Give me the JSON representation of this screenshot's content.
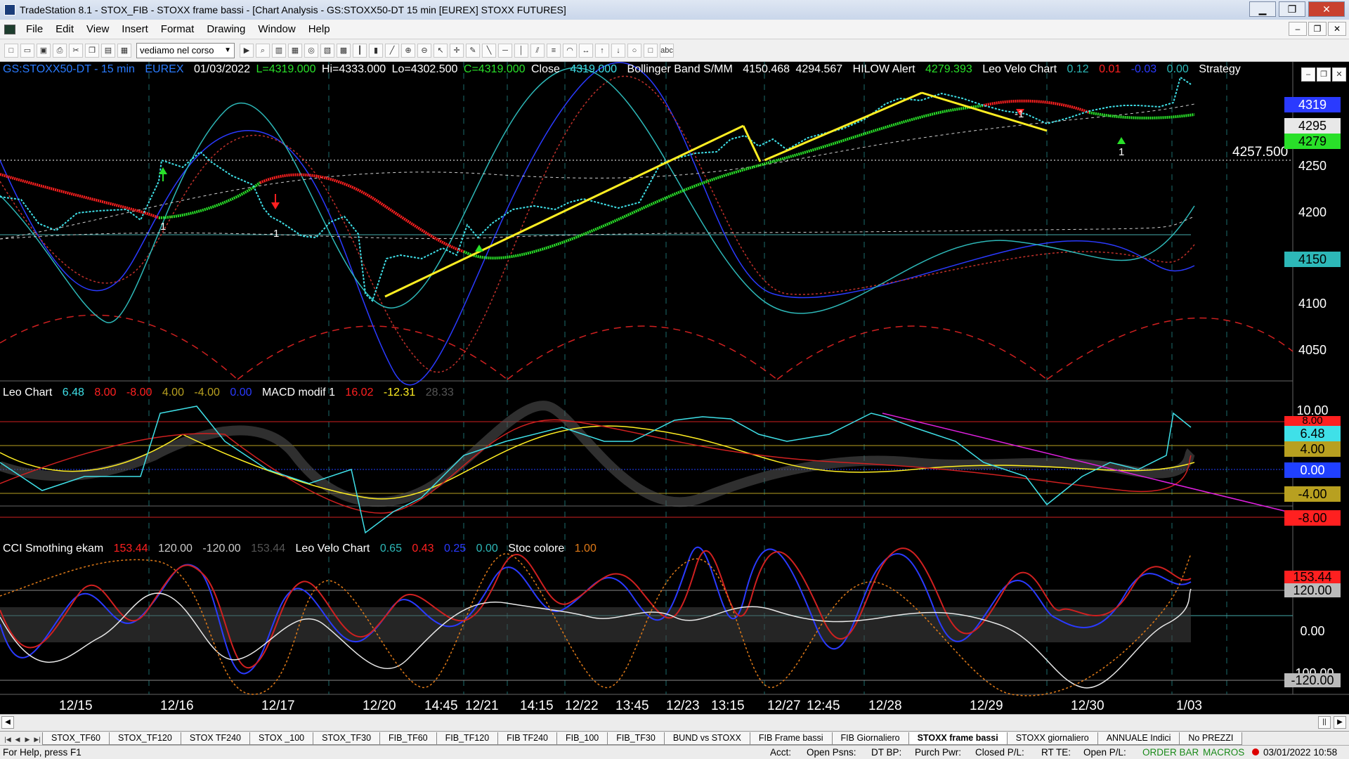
{
  "window": {
    "title": "TradeStation 8.1 - STOX_FIB - STOXX frame bassi - [Chart Analysis - GS:STOXX50-DT  15 min  [EUREX] STOXX FUTURES]",
    "minimize": "▁",
    "restore": "❐",
    "close": "✕"
  },
  "menu": [
    "File",
    "Edit",
    "View",
    "Insert",
    "Format",
    "Drawing",
    "Window",
    "Help"
  ],
  "mdi_buttons": [
    "–",
    "❐",
    "✕"
  ],
  "toolbar": {
    "select_value": "vediamo nel corso",
    "icons": [
      "new-icon",
      "open-icon",
      "save-icon",
      "print-icon",
      "cut-icon",
      "copy-icon",
      "paste-icon",
      "chart-icon",
      "matrix-icon",
      "radar-icon",
      "scanner-icon",
      "zoom-in-icon",
      "zoom-out-icon",
      "pointer-icon",
      "crosshair-icon",
      "trendline-icon",
      "horizontal-line-icon",
      "fibonacci-icon",
      "text-icon"
    ]
  },
  "panes": {
    "price": {
      "symbol": "GS:STOXX50-DT - 15 min",
      "exchange": "EUREX",
      "date": "01/03/2022",
      "last": "L=4319.000",
      "high": "Hi=4333.000",
      "low": "Lo=4302.500",
      "close_val": "C=4319.000",
      "close_lbl": "Close",
      "close_num": "4319.000",
      "bb_lbl": "Bollinger Band S/MM",
      "bb1": "4150.468",
      "bb2": "4294.567",
      "hilow_lbl": "HILOW Alert",
      "hilow": "4279.393",
      "leo_lbl": "Leo Velo Chart",
      "leo1": "0.12",
      "leo2": "0.01",
      "leo3": "-0.03",
      "leo4": "0.00",
      "strategy_lbl": "Strategy",
      "hline_label": "4257.500",
      "marker_neg1": "-1",
      "marker_pos1": "1",
      "tags": {
        "t4319": "4319",
        "t4295": "4295",
        "t4279": "4279",
        "t4150": "4150"
      },
      "axis": [
        "4250",
        "4200",
        "4150",
        "4100",
        "4050"
      ]
    },
    "macd": {
      "leo_lbl": "Leo Chart",
      "v1": "6.48",
      "v2": "8.00",
      "v3": "-8.00",
      "v4": "4.00",
      "v5": "-4.00",
      "v6": "0.00",
      "macd_lbl": "MACD modif 1",
      "m1": "16.02",
      "m2": "-12.31",
      "m3": "28.33",
      "axis_top": "10.00",
      "tags": {
        "t800": "8.00",
        "t648": "6.48",
        "t400": "4.00",
        "t000": "0.00",
        "tm400": "-4.00",
        "tm800": "-8.00"
      }
    },
    "cci": {
      "cci_lbl": "CCI Smothing ekam",
      "c1": "153.44",
      "c2": "120.00",
      "c3": "-120.00",
      "c4": "153.44",
      "leo_lbl": "Leo Velo Chart",
      "l1": "0.65",
      "l2": "0.43",
      "l3": "0.25",
      "l4": "0.00",
      "stoc_lbl": "Stoc colore",
      "s1": "1.00",
      "axis_mid": "0.00",
      "axis_low": "-100.00",
      "tags": {
        "t153": "153.44",
        "t120": "120.00",
        "tm120": "-120.00"
      }
    }
  },
  "xaxis": [
    "12/15",
    "12/16",
    "12/17",
    "12/20",
    "14:45",
    "12/21",
    "14:15",
    "12/22",
    "13:45",
    "12/23",
    "13:15",
    "12/27",
    "12:45",
    "12/28",
    "12/29",
    "12/30",
    "1/03"
  ],
  "tabs": [
    "STOX_TF60",
    "STOX_TF120",
    "STOX TF240",
    "STOX _100",
    "STOX_TF30",
    "FIB_TF60",
    "FIB_TF120",
    "FIB TF240",
    "FIB_100",
    "FIB_TF30",
    "BUND vs STOXX",
    "FIB Frame bassi",
    "FIB Giornaliero",
    "STOXX frame bassi",
    "STOXX giornaliero",
    "ANNUALE Indici",
    "No PREZZI"
  ],
  "active_tab": "STOXX frame bassi",
  "status": {
    "help": "For Help, press F1",
    "acct": "Acct:",
    "open_psns": "Open Psns:",
    "dt_bp": "DT BP:",
    "purch_pwr": "Purch Pwr:",
    "closed_pl": "Closed P/L:",
    "rt_te": "RT TE:",
    "open_pl": "Open P/L:",
    "order_bar": "ORDER BAR",
    "macros": "MACROS",
    "datetime": "03/01/2022 10:58"
  },
  "colors": {
    "cyan": "#3fe0e8",
    "yellow": "#ffee22",
    "red": "#ff2020",
    "green": "#29e029",
    "blue": "#2040ff",
    "magenta": "#e020e0",
    "grid": "#1f6f6f"
  }
}
